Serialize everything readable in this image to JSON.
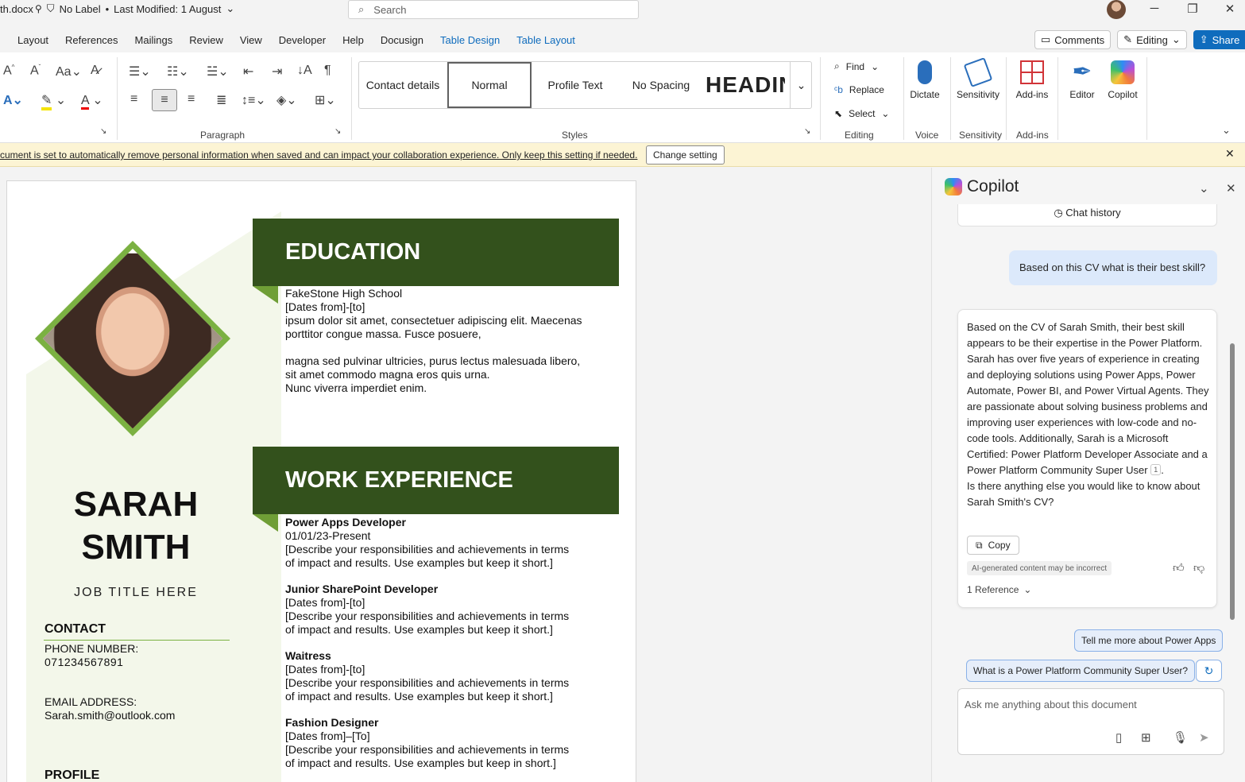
{
  "titlebar": {
    "filename": "th.docx",
    "sensitivity": "No Label",
    "modified": "Last Modified: 1 August",
    "search_placeholder": "Search"
  },
  "window": {
    "minimize": "─",
    "restore": "❐",
    "close": "✕"
  },
  "tabs": [
    "Layout",
    "References",
    "Mailings",
    "Review",
    "View",
    "Developer",
    "Help",
    "Docusign",
    "Table Design",
    "Table Layout"
  ],
  "top_buttons": {
    "comments": "Comments",
    "editing": "Editing",
    "share": "Share"
  },
  "ribbon": {
    "paragraph_label": "Paragraph",
    "styles_label": "Styles",
    "editing_label": "Editing",
    "voice_label": "Voice",
    "sensitivity_label": "Sensitivity",
    "addins_label": "Add-ins",
    "styles": [
      "Contact details",
      "Normal",
      "Profile Text",
      "No Spacing",
      "HEADIN"
    ],
    "selected_style": "Normal",
    "find": "Find",
    "replace": "Replace",
    "select": "Select",
    "dictate": "Dictate",
    "sensitivity_btn": "Sensitivity",
    "addins_btn": "Add-ins",
    "editor_btn": "Editor",
    "copilot_btn": "Copilot"
  },
  "infobar": {
    "message": "cument is set to automatically remove personal information when saved and can impact your collaboration experience. Only keep this setting if needed.",
    "button": "Change setting"
  },
  "document": {
    "name_line1": "SARAH",
    "name_line2": "SMITH",
    "job_title": "JOB TITLE HERE",
    "contact_heading": "CONTACT",
    "phone_label": "PHONE NUMBER:",
    "phone": "071234567891",
    "email_label": "EMAIL ADDRESS:",
    "email": "Sarah.smith@outlook.com",
    "profile_heading": "PROFILE",
    "education_heading": "EDUCATION",
    "education": {
      "school": "FakeStone High School",
      "dates": "[Dates from]-[to]",
      "p1a": "ipsum dolor sit amet, consectetuer adipiscing elit. Maecenas",
      "p1b": "porttitor congue massa. Fusce posuere,",
      "p2a": "magna sed pulvinar ultricies, purus lectus malesuada libero,",
      "p2b": "sit amet commodo magna eros quis urna.",
      "p2c": "Nunc viverra imperdiet enim."
    },
    "work_heading": "WORK EXPERIENCE",
    "jobs": [
      {
        "title": "Power Apps Developer",
        "dates": "01/01/23-Present",
        "desc1": "[Describe your responsibilities and achievements in terms",
        "desc2": "of impact and results. Use examples but keep it short.]"
      },
      {
        "title": "Junior SharePoint Developer",
        "dates": "[Dates from]-[to]",
        "desc1": "[Describe your responsibilities and achievements in terms",
        "desc2": "of impact and results. Use examples but keep it short.]"
      },
      {
        "title": "Waitress",
        "dates": "[Dates from]-[to]",
        "desc1": "[Describe your responsibilities and achievements in terms",
        "desc2": "of impact and results. Use examples but keep it short.]"
      },
      {
        "title": "Fashion Designer",
        "dates": "[Dates from]–[To]",
        "desc1": "[Describe your responsibilities and achievements in terms",
        "desc2": "of impact and results. Use examples but keep in short.]"
      }
    ]
  },
  "copilot": {
    "title": "Copilot",
    "chat_history": "Chat history",
    "user_message": "Based on this CV what is their best skill?",
    "ai_response": "Based on the CV of Sarah Smith, their best skill appears to be their expertise in the Power Platform. Sarah has over five years of experience in creating and deploying solutions using Power Apps, Power Automate, Power BI, and Power Virtual Agents. They are passionate about solving business problems and improving user experiences with low-code and no-code tools. Additionally, Sarah is a Microsoft Certified: Power Platform Developer Associate and a Power Platform Community Super User",
    "ref_marker": "1",
    "ai_followup": "Is there anything else you would like to know about Sarah Smith's CV?",
    "copy": "Copy",
    "disclaimer": "AI-generated content may be incorrect",
    "references": "1 Reference",
    "suggestion1": "Tell me more about Power Apps",
    "suggestion2": "What is a Power Platform Community Super User?",
    "ask_placeholder": "Ask me anything about this document"
  },
  "colors": {
    "accent": "#0f6cbd",
    "banner": "#33511c",
    "green": "#7bb142",
    "sidebar": "#f3f7ea"
  }
}
